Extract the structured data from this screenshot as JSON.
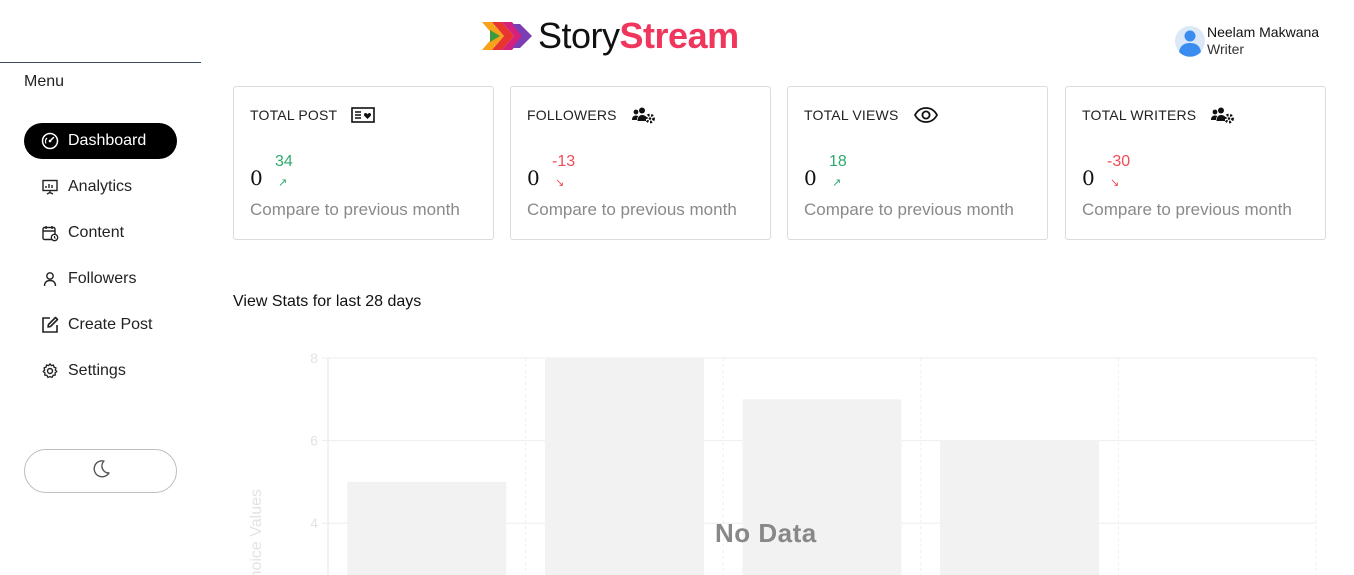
{
  "header": {
    "logo_part1": "Story",
    "logo_part2": "Stream",
    "colors": {
      "accent": "#f0365c"
    }
  },
  "user": {
    "name": "Neelam Makwana",
    "role": "Writer",
    "avatar_icon": "user-avatar-icon"
  },
  "sidebar": {
    "menu_label": "Menu",
    "items": [
      {
        "label": "Dashboard",
        "icon": "gauge-icon",
        "active": true
      },
      {
        "label": "Analytics",
        "icon": "presentation-chart-icon",
        "active": false
      },
      {
        "label": "Content",
        "icon": "calendar-clock-icon",
        "active": false
      },
      {
        "label": "Followers",
        "icon": "user-icon",
        "active": false
      },
      {
        "label": "Create Post",
        "icon": "edit-icon",
        "active": false
      },
      {
        "label": "Settings",
        "icon": "gear-icon",
        "active": false
      }
    ],
    "theme_toggle_icon": "moon-icon"
  },
  "cards": [
    {
      "title": "TOTAL POST",
      "icon": "news-icon",
      "value": "0",
      "change": "34",
      "trend": "up",
      "compare": "Compare to previous month"
    },
    {
      "title": "FOLLOWERS",
      "icon": "users-gear-icon",
      "value": "0",
      "change": "-13",
      "trend": "down",
      "compare": "Compare to previous month"
    },
    {
      "title": "TOTAL VIEWS",
      "icon": "eye-icon",
      "value": "0",
      "change": "18",
      "trend": "up",
      "compare": "Compare to previous month"
    },
    {
      "title": "TOTAL WRITERS",
      "icon": "users-gear-icon",
      "value": "0",
      "change": "-30",
      "trend": "down",
      "compare": "Compare to previous month"
    }
  ],
  "stats": {
    "title": "View Stats for last 28 days",
    "no_data": "No Data"
  },
  "chart_data": {
    "type": "bar",
    "categories": [
      "",
      "",
      "",
      "",
      ""
    ],
    "values": [
      5,
      8,
      7,
      6,
      0
    ],
    "yticks": [
      "8",
      "6",
      "4"
    ],
    "ylabel": "Choice Values",
    "ylim": [
      0,
      8
    ],
    "grid": true,
    "colors": {
      "bar": "#f2f2f2",
      "grid": "#eeeeee",
      "axis_text": "#e3e3e3"
    }
  }
}
